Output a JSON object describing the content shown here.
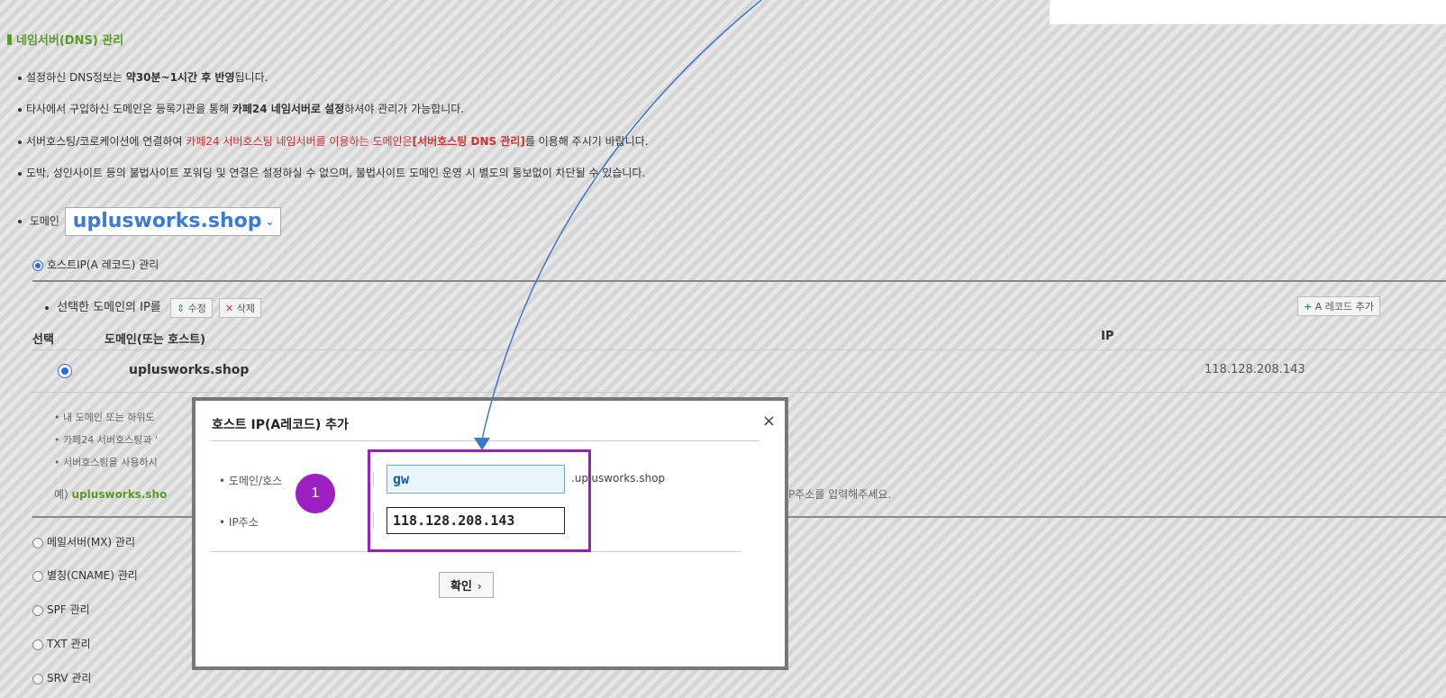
{
  "section": {
    "title": "네임서버(DNS) 관리"
  },
  "notices": [
    {
      "parts": [
        {
          "t": "설정하신 DNS정보는 "
        },
        {
          "t": "약30분~1시간 후 반영",
          "cls": "b"
        },
        {
          "t": "됩니다."
        }
      ]
    },
    {
      "parts": [
        {
          "t": "타사에서 구입하신 도메인은 등록기관을 통해 "
        },
        {
          "t": "카페24 네임서버로 설정",
          "cls": "b"
        },
        {
          "t": "하셔야 관리가 가능합니다."
        }
      ]
    },
    {
      "parts": [
        {
          "t": "서버호스팅/코로케이션에 연결하여 "
        },
        {
          "t": "카페24 서버호스팅 네임서버를 이용하는 도메인은",
          "cls": "r"
        },
        {
          "t": "[서버호스팅 DNS 관리]",
          "cls": "rb"
        },
        {
          "t": "를 이용해 주시기 바랍니다."
        }
      ]
    },
    {
      "parts": [
        {
          "t": "도박, 성인사이트 등의 불법사이트 포워딩 및 연결은 설정하실 수 없으며, 불법사이트 도메인 운영 시 별도의 통보없이 차단될 수 있습니다."
        }
      ]
    }
  ],
  "domain": {
    "label": "도메인",
    "selected": "uplusworks.shop"
  },
  "host_mgmt": {
    "label": "호스트IP(A 레코드) 관리"
  },
  "ip_toolbar": {
    "label": "선택한 도메인의 IP를",
    "edit": "수정",
    "delete": "삭제",
    "add": "A 레코드 추가"
  },
  "table": {
    "headers": {
      "select": "선택",
      "domain": "도메인(또는 호스트)",
      "ip": "IP"
    },
    "rows": [
      {
        "domain": "uplusworks.shop",
        "ip": "118.128.208.143"
      }
    ]
  },
  "hints": [
    "내 도메인 또는 하위도",
    "카페24 서버호스팅과 '",
    "서버호스팅을 사용하시"
  ],
  "hint_example": {
    "prefix": "예) ",
    "domain": "uplusworks.sho"
  },
  "hint_right": "P주소를 입력해주세요.",
  "other_records": [
    "메일서버(MX) 관리",
    "별칭(CNAME) 관리",
    "SPF 관리",
    "TXT 관리",
    "SRV 관리"
  ],
  "modal": {
    "title": "호스트 IP(A레코드) 추가",
    "host_label": "도메인/호스",
    "host_value": "gw",
    "suffix": ".uplusworks.shop",
    "ip_label": "IP주소",
    "ip_value": "118.128.208.143",
    "ok": "확인",
    "close": "×"
  },
  "annotation": {
    "step": "1",
    "color": "#9b1fc1"
  },
  "colors": {
    "green": "#5a9a2a",
    "red": "#d32f2f",
    "blue": "#3a7bd5",
    "arrow": "#3d78c9"
  }
}
